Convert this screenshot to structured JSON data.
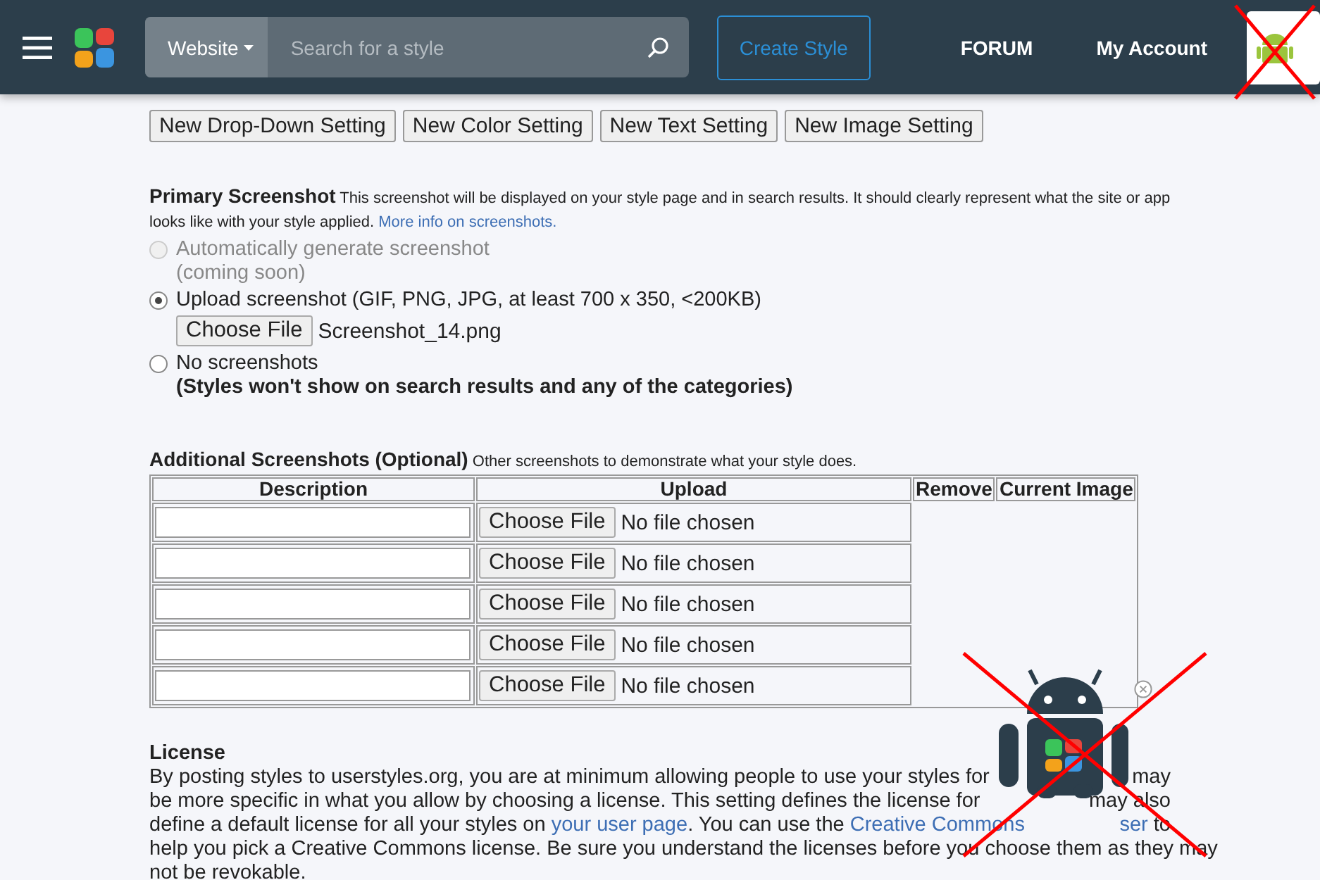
{
  "header": {
    "category": "Website",
    "search": {
      "placeholder": "Search for a style"
    },
    "create_button": "Create Style",
    "nav": [
      "FORUM",
      "My Account"
    ]
  },
  "setting_buttons": [
    "New Drop-Down Setting",
    "New Color Setting",
    "New Text Setting",
    "New Image Setting"
  ],
  "primary": {
    "title": "Primary Screenshot",
    "description": "This screenshot will be displayed on your style page and in search results. It should clearly represent what the site or app looks like with your style applied.",
    "link": "More info on screenshots.",
    "options": [
      {
        "kind": "plain",
        "label": "Automatically generate screenshot",
        "note": "(coming soon)",
        "selected": false,
        "disabled": true
      },
      {
        "kind": "file",
        "label": "Upload screenshot (GIF, PNG, JPG, at least 700 x 350, <200KB)",
        "button": "Choose File",
        "file": "Screenshot_14.png",
        "selected": true,
        "disabled": false
      },
      {
        "kind": "warning",
        "label": "No screenshots",
        "note": "(Styles won't show on search results and any of the categories)",
        "selected": false,
        "disabled": false
      }
    ]
  },
  "additional": {
    "title": "Additional Screenshots (Optional)",
    "description": "Other screenshots to demonstrate what your style does.",
    "columns": [
      "Description",
      "Upload",
      "Remove",
      "Current Image"
    ],
    "rows": [
      {
        "button": "Choose File",
        "file": "No file chosen"
      },
      {
        "button": "Choose File",
        "file": "No file chosen"
      },
      {
        "button": "Choose File",
        "file": "No file chosen"
      },
      {
        "button": "Choose File",
        "file": "No file chosen"
      },
      {
        "button": "Choose File",
        "file": "No file chosen"
      }
    ]
  },
  "license": {
    "title": "License",
    "lines": [
      {
        "left": [
          {
            "kind": "text",
            "text": "By posting styles to userstyles.org, you are at minimum allowing people to use your styles for"
          }
        ],
        "right": [
          {
            "kind": "text",
            "text": "may"
          }
        ]
      },
      {
        "left": [
          {
            "kind": "text",
            "text": "be more specific in what you allow by choosing a license. This setting defines the license for"
          }
        ],
        "right": [
          {
            "kind": "text",
            "text": "may also"
          }
        ]
      },
      {
        "left": [
          {
            "kind": "text",
            "text": "define a default license for all your styles on "
          },
          {
            "kind": "link",
            "text": "your user page"
          },
          {
            "kind": "text",
            "text": ". You can use the "
          },
          {
            "kind": "link",
            "text": "Creative Commons"
          }
        ],
        "right": [
          {
            "kind": "link",
            "text": "ser"
          },
          {
            "kind": "text",
            "text": " to"
          }
        ]
      },
      {
        "left": [
          {
            "kind": "text",
            "text": "help you pick a Creative Commons license. Be sure you understand the licenses before you choose them as they may"
          }
        ]
      },
      {
        "left": [
          {
            "kind": "text",
            "text": "not be revokable."
          }
        ]
      }
    ]
  }
}
